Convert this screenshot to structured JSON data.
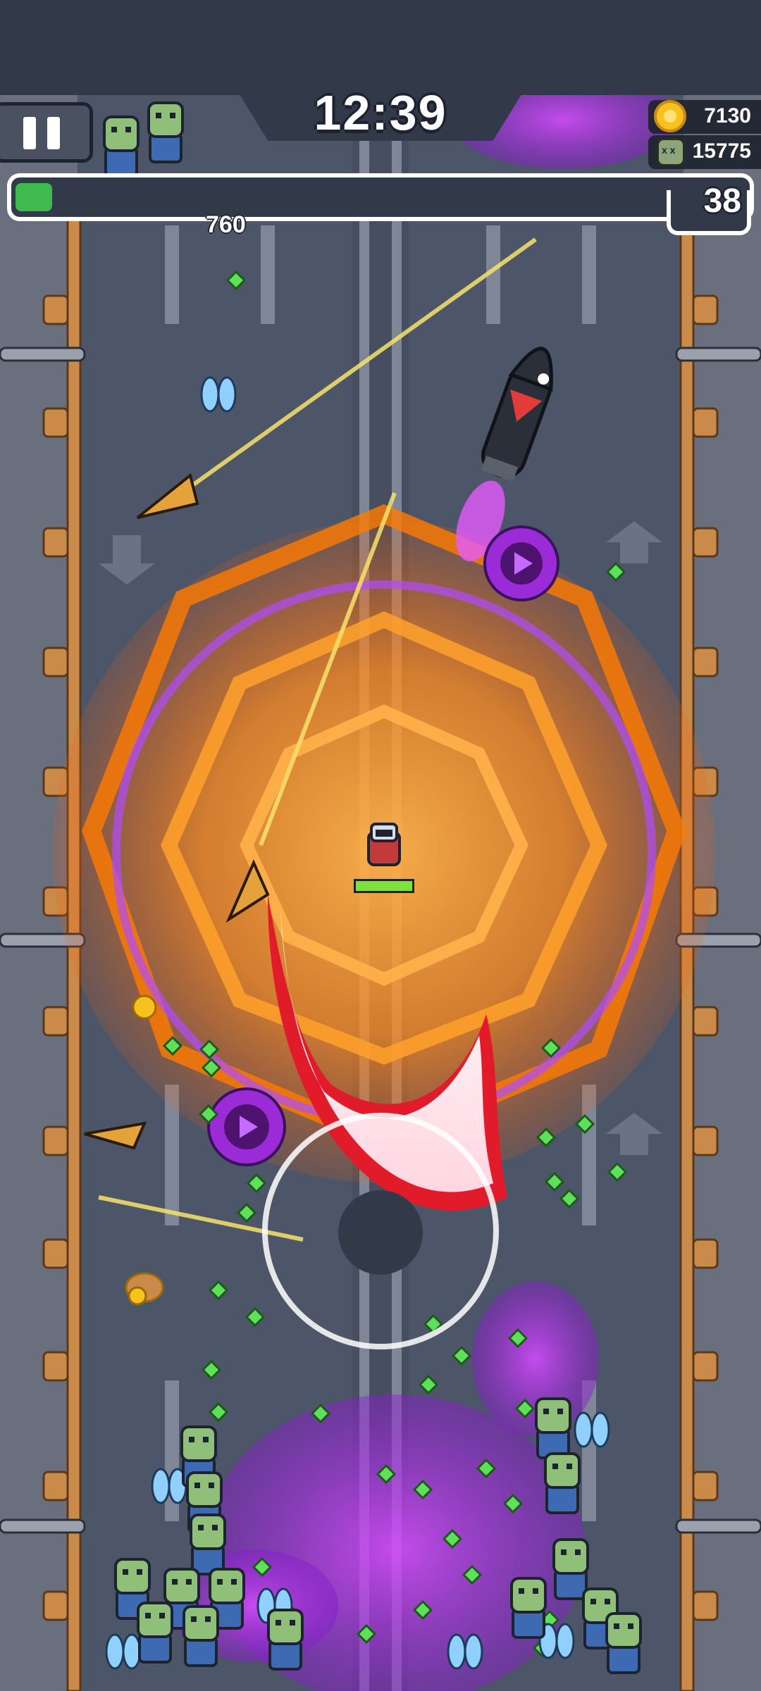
{
  "hud": {
    "timer": "12:39",
    "coins": "7130",
    "kills": "15775",
    "level": "38",
    "xp_progress": 0.05,
    "damage_number": "760",
    "pause_icon": "pause-icon",
    "coin_icon": "coin-icon",
    "kills_icon": "zombie-skull-icon"
  },
  "player": {
    "health_fraction": 1.0,
    "hp_color": "#7fe23a"
  },
  "joystick": {
    "ring_icon": "joystick-ring",
    "knob_icon": "joystick-knob"
  },
  "colors": {
    "road": "#4d5668",
    "road_dark": "#464e5f",
    "lane_line": "#a9b0bd",
    "sidewalk": "#6a6f7d",
    "fence": "#c98a4a",
    "explosion": "#ff8a1d",
    "poison": "#b92cf0",
    "gem": "#5fe05a",
    "xp_fill": "#3fbb4e"
  }
}
